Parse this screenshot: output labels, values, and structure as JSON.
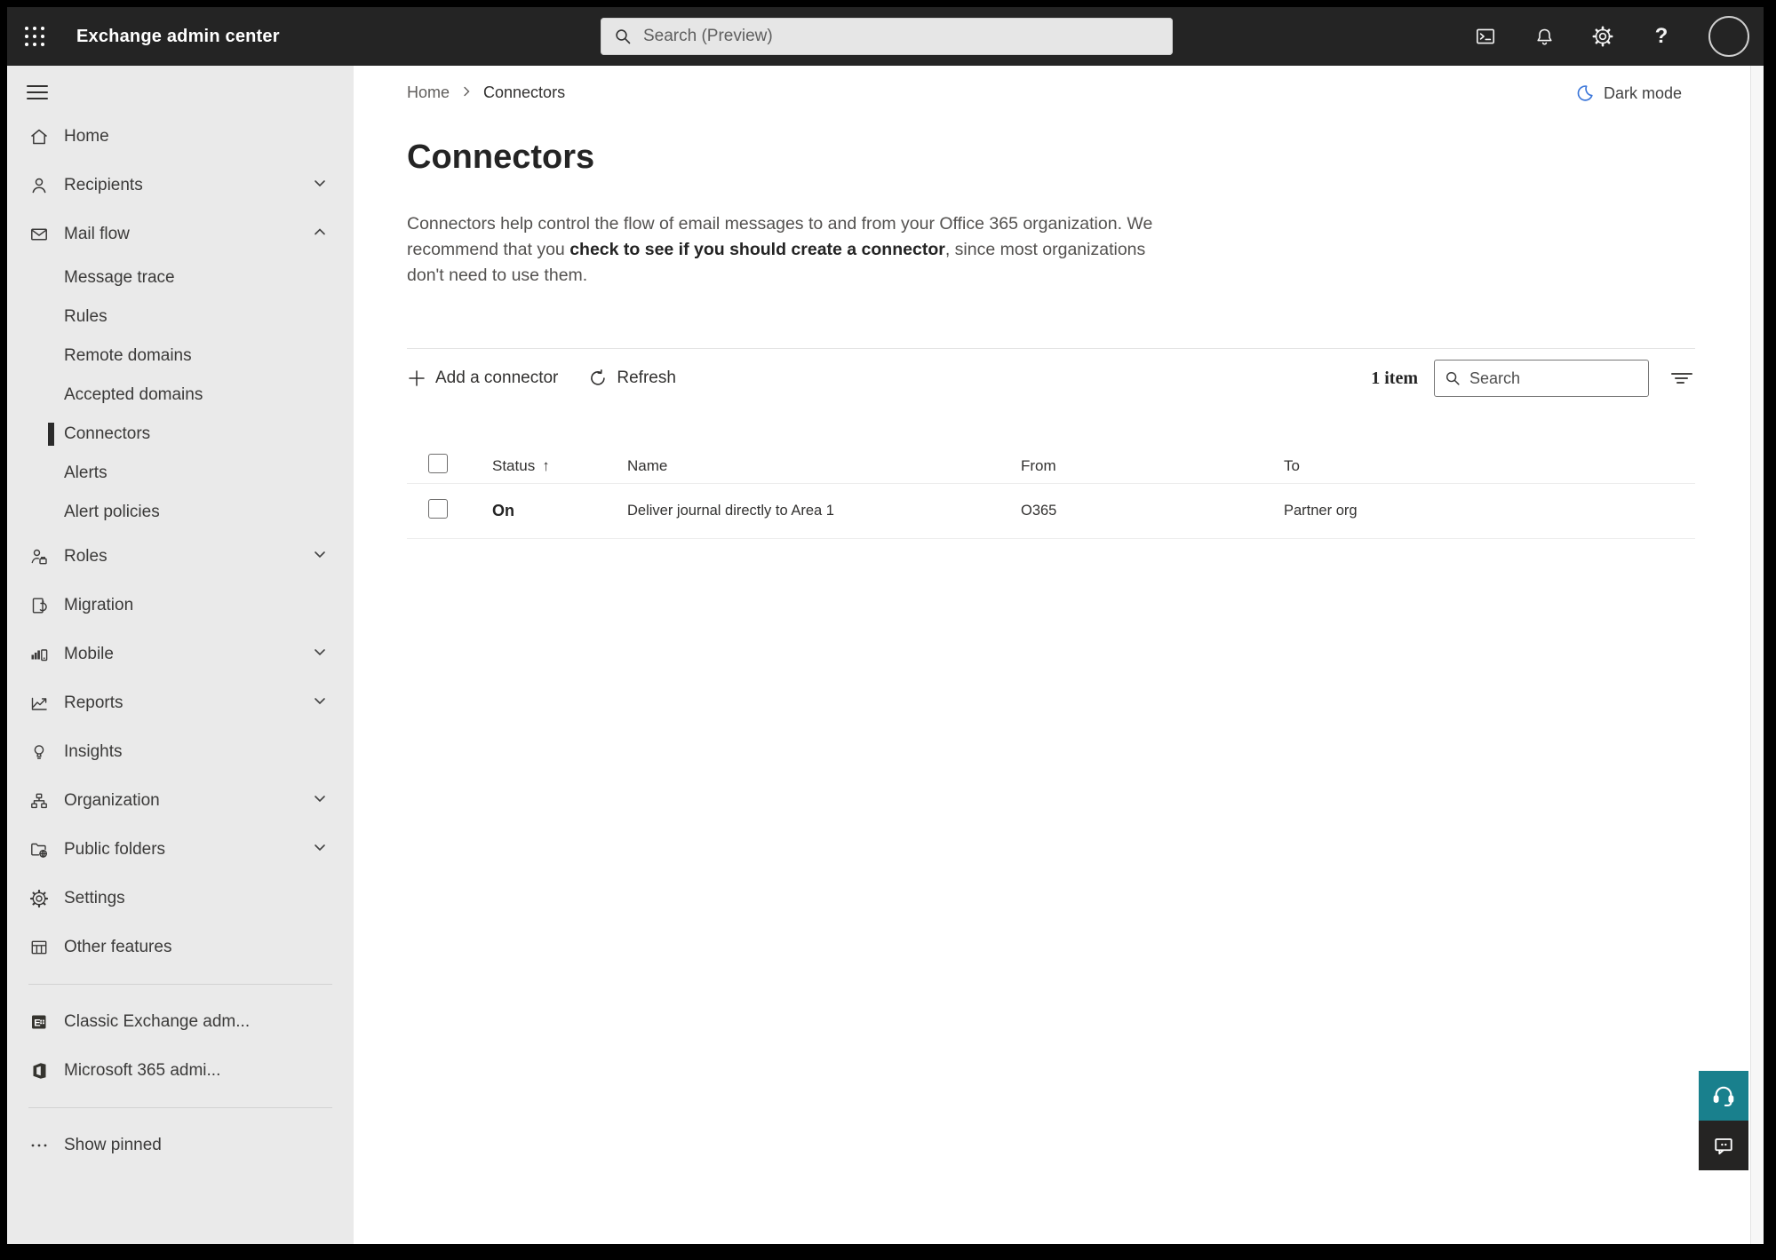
{
  "topbar": {
    "title": "Exchange admin center",
    "search_placeholder": "Search (Preview)",
    "help_glyph": "?"
  },
  "theme_toggle": {
    "label": "Dark mode"
  },
  "breadcrumb": {
    "home": "Home",
    "current": "Connectors"
  },
  "page": {
    "title": "Connectors",
    "description_1": "Connectors help control the flow of email messages to and from your Office 365 organization. We recommend that you ",
    "description_bold": "check to see if you should create a connector",
    "description_2": ", since most organizations don't need to use them."
  },
  "toolbar": {
    "add_label": "Add a connector",
    "refresh_label": "Refresh",
    "item_count": "1 item",
    "search_placeholder": "Search"
  },
  "table": {
    "headers": {
      "status": "Status",
      "name": "Name",
      "from": "From",
      "to": "To"
    },
    "sort_indicator": "↑",
    "rows": [
      {
        "status": "On",
        "name": "Deliver journal directly to Area 1",
        "from": "O365",
        "to": "Partner org"
      }
    ]
  },
  "sidebar": {
    "items": [
      {
        "label": "Home"
      },
      {
        "label": "Recipients"
      },
      {
        "label": "Mail flow"
      },
      {
        "label": "Message trace"
      },
      {
        "label": "Rules"
      },
      {
        "label": "Remote domains"
      },
      {
        "label": "Accepted domains"
      },
      {
        "label": "Connectors"
      },
      {
        "label": "Alerts"
      },
      {
        "label": "Alert policies"
      },
      {
        "label": "Roles"
      },
      {
        "label": "Migration"
      },
      {
        "label": "Mobile"
      },
      {
        "label": "Reports"
      },
      {
        "label": "Insights"
      },
      {
        "label": "Organization"
      },
      {
        "label": "Public folders"
      },
      {
        "label": "Settings"
      },
      {
        "label": "Other features"
      },
      {
        "label": "Classic Exchange adm..."
      },
      {
        "label": "Microsoft 365 admi..."
      },
      {
        "label": "Show pinned"
      }
    ]
  },
  "colors": {
    "topbar": "#242424",
    "sidebar_bg": "#eaeaea",
    "teal": "#19808d",
    "feedback_bg": "#252423",
    "moon_blue": "#3b76d9"
  }
}
